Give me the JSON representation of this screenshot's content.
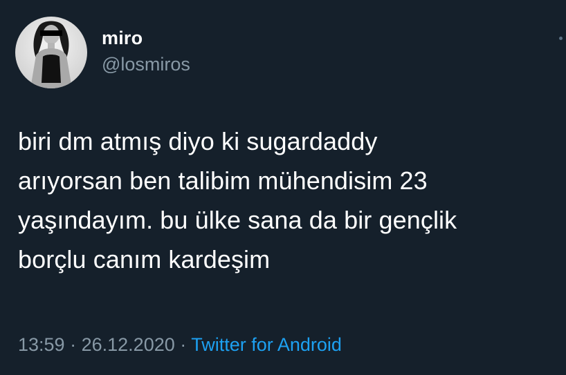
{
  "user": {
    "display_name": "miro",
    "handle": "@losmiros",
    "avatar_icon": "profile-photo"
  },
  "tweet": {
    "lines": [
      "biri dm atmış diyo ki sugardaddy",
      "arıyorsan ben talibim mühendisim 23",
      "yaşındayım. bu ülke sana da bir gençlik",
      "borçlu canım kardeşim"
    ],
    "time": "13:59",
    "separator": "·",
    "date": "26.12.2020",
    "source": "Twitter for Android"
  },
  "colors": {
    "background": "#15202b",
    "text": "#ffffff",
    "secondary_text": "#8899a6",
    "link": "#1da1f2"
  },
  "more_icon": "more-options-icon"
}
